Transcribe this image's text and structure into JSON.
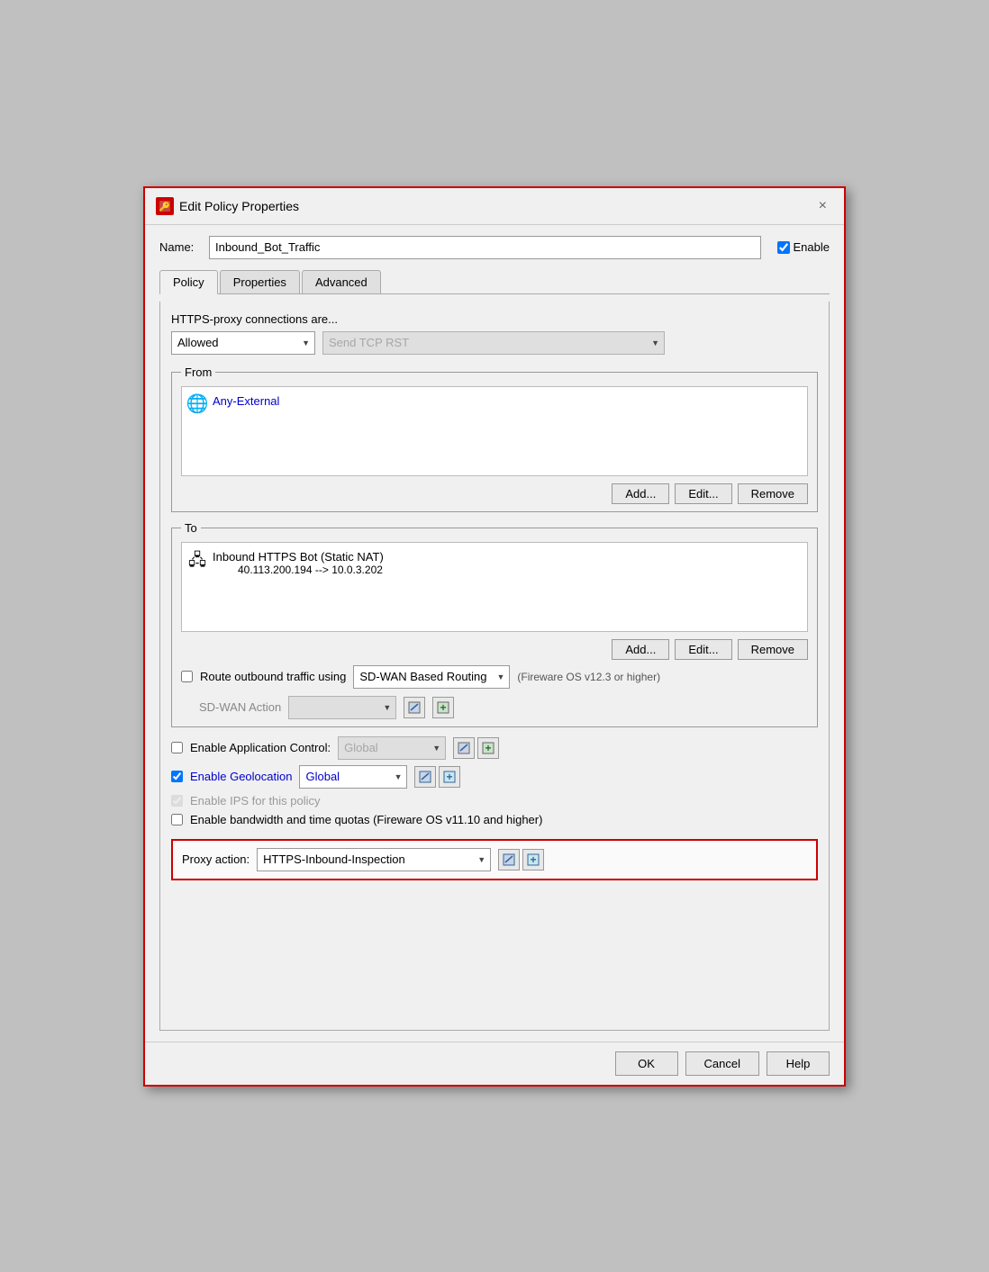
{
  "dialog": {
    "title": "Edit Policy Properties",
    "icon_text": "🔑",
    "close_label": "×"
  },
  "name_field": {
    "label": "Name:",
    "value": "Inbound_Bot_Traffic",
    "placeholder": ""
  },
  "enable_checkbox": {
    "label": "Enable",
    "checked": true
  },
  "tabs": [
    {
      "id": "policy",
      "label": "Policy",
      "active": true
    },
    {
      "id": "properties",
      "label": "Properties",
      "active": false
    },
    {
      "id": "advanced",
      "label": "Advanced",
      "active": false
    }
  ],
  "https_section": {
    "label": "HTTPS-proxy connections are...",
    "dropdown1_value": "Allowed",
    "dropdown2_value": "Send TCP RST",
    "dropdown2_disabled": true
  },
  "from_section": {
    "legend": "From",
    "items": [
      {
        "text": "Any-External",
        "subtext": ""
      }
    ],
    "buttons": {
      "add": "Add...",
      "edit": "Edit...",
      "remove": "Remove"
    }
  },
  "to_section": {
    "legend": "To",
    "items": [
      {
        "text": "Inbound HTTPS Bot (Static NAT)",
        "subtext": "40.113.200.194 --> 10.0.3.202"
      }
    ],
    "buttons": {
      "add": "Add...",
      "edit": "Edit...",
      "remove": "Remove"
    }
  },
  "route_outbound": {
    "label": "Route outbound traffic using",
    "dropdown_value": "SD-WAN Based Routing",
    "note": "(Fireware OS v12.3 or higher)",
    "checked": false
  },
  "sdwan_action": {
    "label": "SD-WAN Action"
  },
  "app_control": {
    "label": "Enable Application Control:",
    "checked": false,
    "dropdown_value": "Global",
    "disabled": false
  },
  "geolocation": {
    "label": "Enable Geolocation",
    "checked": true,
    "dropdown_value": "Global",
    "link_color": "#0000cc"
  },
  "ips": {
    "label": "Enable IPS for this policy",
    "checked": true,
    "disabled": true
  },
  "bandwidth": {
    "label": "Enable bandwidth and time quotas (Fireware OS v11.10 and higher)",
    "checked": false
  },
  "proxy_action": {
    "label": "Proxy action:",
    "value": "HTTPS-Inbound-Inspection"
  },
  "footer": {
    "ok": "OK",
    "cancel": "Cancel",
    "help": "Help"
  }
}
